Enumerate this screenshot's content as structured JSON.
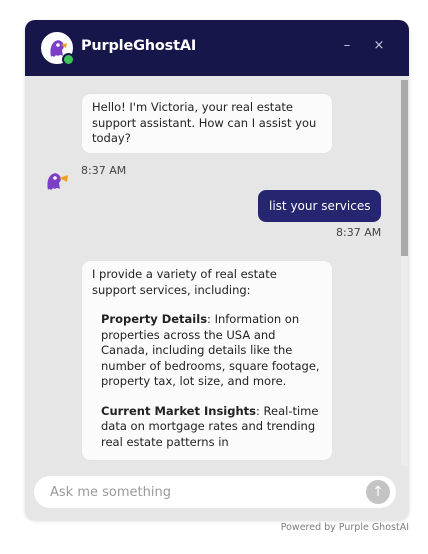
{
  "header": {
    "title": "PurpleGhostAI",
    "minimize_label": "–",
    "close_label": "×"
  },
  "messages": [
    {
      "sender": "bot",
      "text": "Hello! I'm Victoria, your real estate support assistant. How can I assist you today?",
      "time": "8:37 AM"
    },
    {
      "sender": "user",
      "text": "list your services",
      "time": "8:37 AM"
    },
    {
      "sender": "bot",
      "intro": "I provide a variety of real estate support services, including:",
      "items": [
        {
          "title": "Property Details",
          "text": ": Information on properties across the USA and Canada, including details like the number of bedrooms, square footage, property tax, lot size, and more."
        },
        {
          "title": "Current Market Insights",
          "text": ": Real-time data on mortgage rates and trending real estate patterns in"
        }
      ]
    }
  ],
  "input": {
    "placeholder": "Ask me something",
    "value": ""
  },
  "send_icon": "arrow-up",
  "footer": {
    "powered_by": "Powered by Purple GhostAI"
  },
  "colors": {
    "header_bg": "#17164b",
    "user_bubble": "#252570",
    "panel_bg": "#e6e6e6",
    "online": "#3ec45a"
  }
}
